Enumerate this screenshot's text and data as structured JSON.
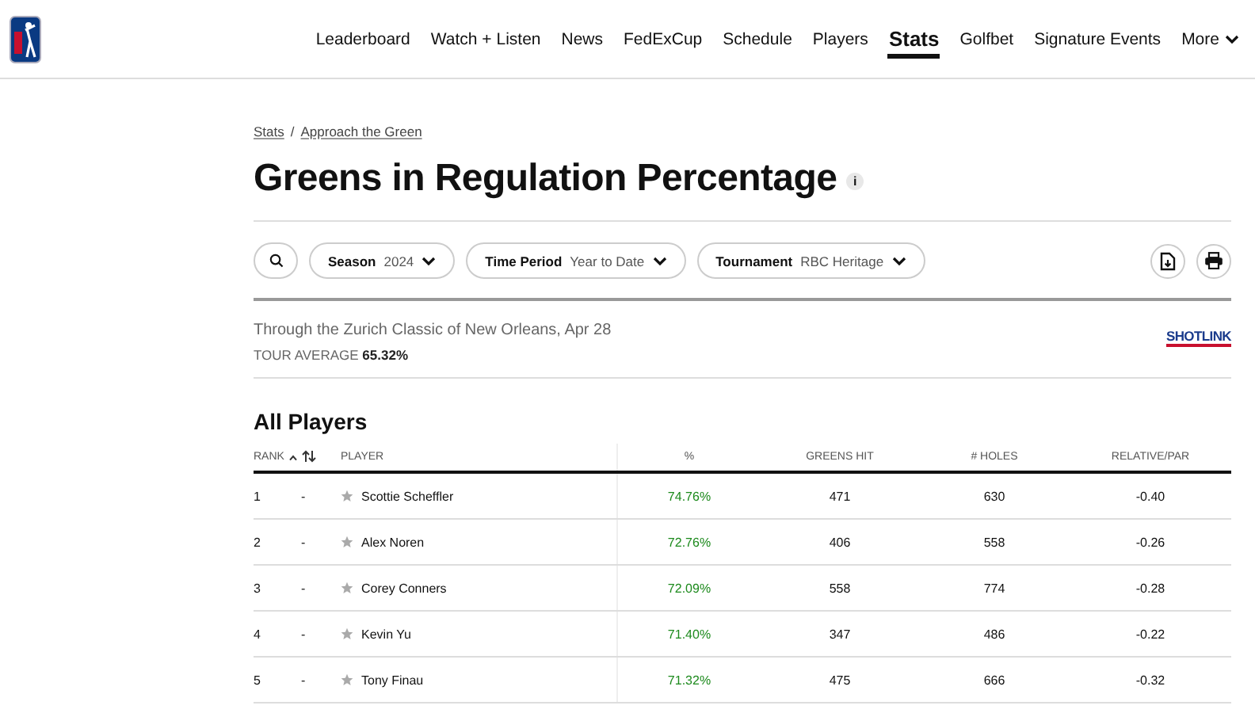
{
  "nav": {
    "items": [
      {
        "label": "Leaderboard",
        "selected": false
      },
      {
        "label": "Watch + Listen",
        "selected": false
      },
      {
        "label": "News",
        "selected": false
      },
      {
        "label": "FedExCup",
        "selected": false
      },
      {
        "label": "Schedule",
        "selected": false
      },
      {
        "label": "Players",
        "selected": false
      },
      {
        "label": "Stats",
        "selected": true
      },
      {
        "label": "Golfbet",
        "selected": false
      },
      {
        "label": "Signature Events",
        "selected": false
      },
      {
        "label": "More",
        "selected": false
      }
    ]
  },
  "breadcrumb": [
    "Stats",
    "Approach the Green"
  ],
  "breadcrumb_separator": "/",
  "title": "Greens in Regulation Percentage",
  "info_icon": "i",
  "filters": [
    {
      "label": "Season",
      "value": "2024"
    },
    {
      "label": "Time Period",
      "value": "Year to Date"
    },
    {
      "label": "Tournament",
      "value": "RBC Heritage"
    }
  ],
  "through": "Through the Zurich Classic of New Orleans, Apr 28",
  "tour_average": {
    "label": "TOUR AVERAGE",
    "value": "65.32%"
  },
  "shotlink": "SHOTLINK",
  "section_title": "All Players",
  "table": {
    "columns": [
      "RANK",
      "PLAYER",
      "%",
      "GREENS HIT",
      "# HOLES",
      "RELATIVE/PAR"
    ],
    "rows": [
      {
        "rank": "1",
        "move": "-",
        "player": "Scottie Scheffler",
        "pct": "74.76%",
        "greens_hit": "471",
        "holes": "630",
        "relative_par": "-0.40"
      },
      {
        "rank": "2",
        "move": "-",
        "player": "Alex Noren",
        "pct": "72.76%",
        "greens_hit": "406",
        "holes": "558",
        "relative_par": "-0.26"
      },
      {
        "rank": "3",
        "move": "-",
        "player": "Corey Conners",
        "pct": "72.09%",
        "greens_hit": "558",
        "holes": "774",
        "relative_par": "-0.28"
      },
      {
        "rank": "4",
        "move": "-",
        "player": "Kevin Yu",
        "pct": "71.40%",
        "greens_hit": "347",
        "holes": "486",
        "relative_par": "-0.22"
      },
      {
        "rank": "5",
        "move": "-",
        "player": "Tony Finau",
        "pct": "71.32%",
        "greens_hit": "475",
        "holes": "666",
        "relative_par": "-0.32"
      }
    ]
  }
}
